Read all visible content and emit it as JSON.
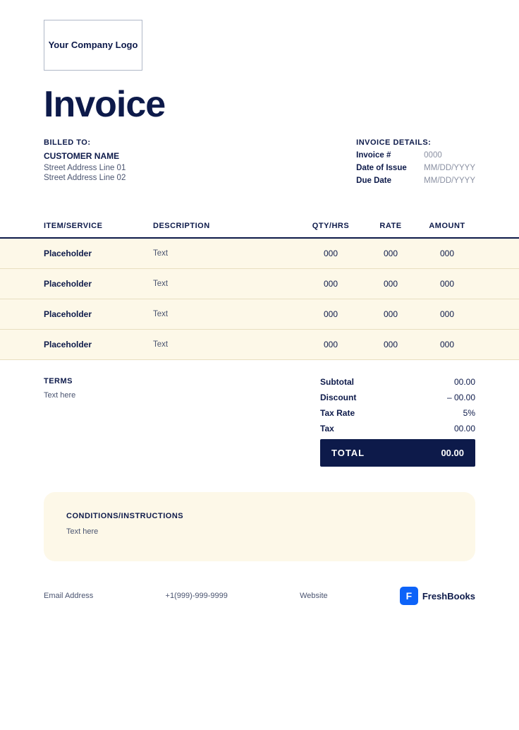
{
  "logo": {
    "text": "Your Company Logo"
  },
  "invoice": {
    "title": "Invoice"
  },
  "billed_to": {
    "label": "BILLED TO:",
    "customer_name": "CUSTOMER NAME",
    "address_line1": "Street Address Line 01",
    "address_line2": "Street Address Line 02"
  },
  "invoice_details": {
    "label": "INVOICE DETAILS:",
    "fields": [
      {
        "label": "Invoice #",
        "value": "0000"
      },
      {
        "label": "Date of Issue",
        "value": "MM/DD/YYYY"
      },
      {
        "label": "Due Date",
        "value": "MM/DD/YYYY"
      }
    ]
  },
  "table": {
    "headers": [
      "ITEM/SERVICE",
      "DESCRIPTION",
      "QTY/HRS",
      "RATE",
      "AMOUNT"
    ],
    "rows": [
      {
        "item": "Placeholder",
        "desc": "Text",
        "qty": "000",
        "rate": "000",
        "amount": "000"
      },
      {
        "item": "Placeholder",
        "desc": "Text",
        "qty": "000",
        "rate": "000",
        "amount": "000"
      },
      {
        "item": "Placeholder",
        "desc": "Text",
        "qty": "000",
        "rate": "000",
        "amount": "000"
      },
      {
        "item": "Placeholder",
        "desc": "Text",
        "qty": "000",
        "rate": "000",
        "amount": "000"
      }
    ]
  },
  "terms": {
    "label": "TERMS",
    "text": "Text here"
  },
  "totals": {
    "subtotal_label": "Subtotal",
    "subtotal_value": "00.00",
    "discount_label": "Discount",
    "discount_value": "– 00.00",
    "tax_rate_label": "Tax Rate",
    "tax_rate_value": "5%",
    "tax_label": "Tax",
    "tax_value": "00.00",
    "total_label": "TOTAL",
    "total_value": "00.00"
  },
  "conditions": {
    "label": "CONDITIONS/INSTRUCTIONS",
    "text": "Text here"
  },
  "footer": {
    "email": "Email Address",
    "phone": "+1(999)-999-9999",
    "website": "Website",
    "brand": "FreshBooks",
    "brand_icon": "F"
  }
}
